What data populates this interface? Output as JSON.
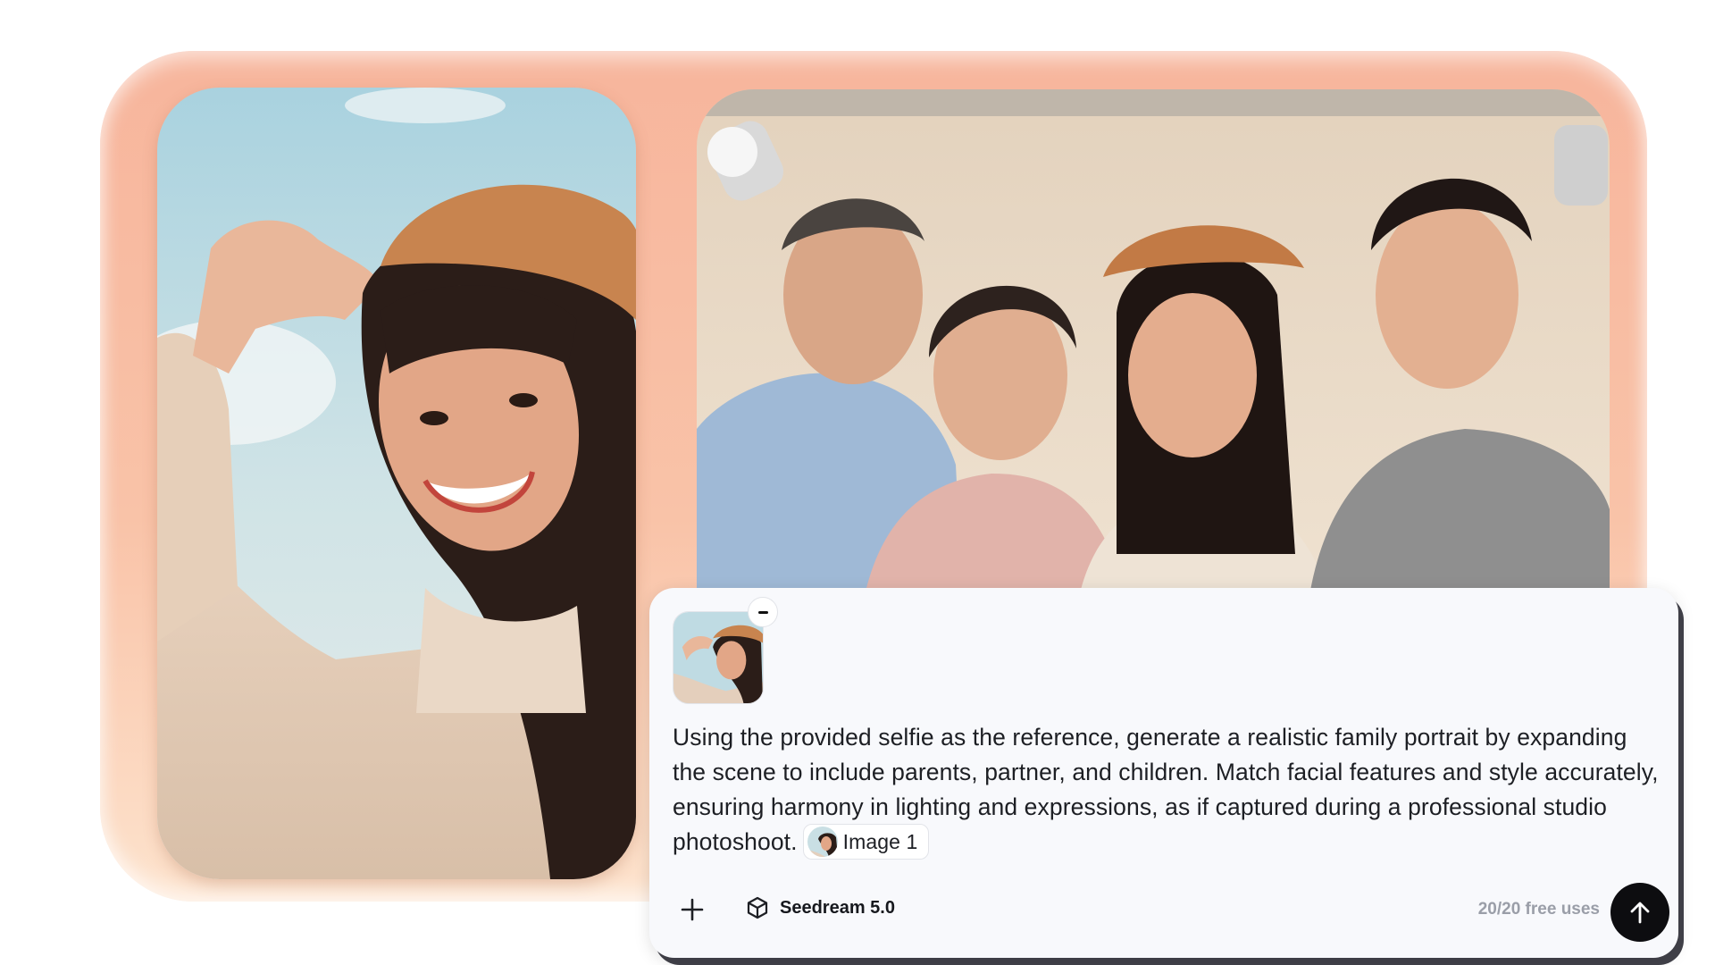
{
  "prompt": {
    "text": "Using the provided selfie as the reference, generate a realistic family portrait by expanding the scene to include parents, partner, and children. Match facial features and style accurately, ensuring harmony in lighting and expressions, as if captured during a professional studio photoshoot.",
    "reference_chip": "Image 1"
  },
  "toolbar": {
    "add_icon": "plus-icon",
    "model_icon": "cube-icon",
    "model_name": "Seedream 5.0",
    "free_uses": "20/20 free uses",
    "send_icon": "arrow-up-icon"
  },
  "attachment": {
    "remove_icon": "minus-icon"
  },
  "colors": {
    "backdrop": "#f7b59c",
    "panel": "#f8f9fc",
    "send_button": "#0d0d10",
    "muted_text": "#9a9ea8"
  }
}
